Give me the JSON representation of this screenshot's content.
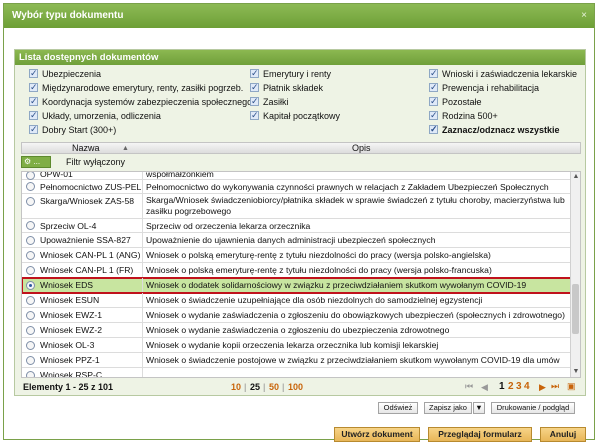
{
  "dialog": {
    "title": "Wybór typu dokumentu",
    "close": "×"
  },
  "panel": {
    "title": "Lista dostępnych dokumentów"
  },
  "filters": {
    "col1": [
      "Ubezpieczenia",
      "Międzynarodowe emerytury, renty, zasiłki pogrzeb.",
      "Koordynacja systemów zabezpieczenia społecznego",
      "Układy, umorzenia, odliczenia",
      "Dobry Start (300+)"
    ],
    "col2": [
      "Emerytury i renty",
      "Płatnik składek",
      "Zasiłki",
      "Kapitał początkowy"
    ],
    "col3": [
      "Wnioski i zaświadczenia lekarskie",
      "Prewencja i rehabilitacja",
      "Pozostałe",
      "Rodzina 500+",
      "Zaznacz/odznacz wszystkie"
    ]
  },
  "table": {
    "col_name": "Nazwa",
    "col_desc": "Opis",
    "filter_btn": "...",
    "filter_status": "Filtr wyłączony",
    "rows": [
      {
        "name": "OPW-01",
        "desc": "współmałżonkiem",
        "selected": false
      },
      {
        "name": "Pełnomocnictwo ZUS-PEL",
        "desc": "Pełnomocnictwo do wykonywania czynności prawnych w relacjach z Zakładem Ubezpieczeń Społecznych",
        "selected": false
      },
      {
        "name": "Skarga/Wniosek ZAS-58",
        "desc": "Skarga/Wniosek świadczeniobiorcy/płatnika składek w sprawie świadczeń z tytułu choroby, macierzyństwa lub zasiłku pogrzebowego",
        "selected": false
      },
      {
        "name": "Sprzeciw OL-4",
        "desc": "Sprzeciw od orzeczenia lekarza orzecznika",
        "selected": false
      },
      {
        "name": "Upoważnienie SSA-827",
        "desc": "Upoważnienie do ujawnienia danych administracji ubezpieczeń społecznych",
        "selected": false
      },
      {
        "name": "Wniosek CAN-PL 1 (ANG)",
        "desc": "Wniosek o polską emeryturę-rentę z tytułu niezdolności do pracy (wersja polsko-angielska)",
        "selected": false
      },
      {
        "name": "Wniosek CAN-PL 1 (FR)",
        "desc": "Wniosek o polską emeryturę-rentę z tytułu niezdolności do pracy (wersja polsko-francuska)",
        "selected": false
      },
      {
        "name": "Wniosek EDS",
        "desc": "Wniosek o dodatek solidarnościowy w związku z przeciwdziałaniem skutkom wywołanym COVID-19",
        "selected": true
      },
      {
        "name": "Wniosek ESUN",
        "desc": "Wniosek o świadczenie uzupełniające dla osób niezdolnych do samodzielnej egzystencji",
        "selected": false
      },
      {
        "name": "Wniosek EWZ-1",
        "desc": "Wniosek o wydanie zaświadczenia o zgłoszeniu do obowiązkowych ubezpieczeń (społecznych i zdrowotnego)",
        "selected": false
      },
      {
        "name": "Wniosek EWZ-2",
        "desc": "Wniosek o wydanie zaświadczenia o zgłoszeniu do ubezpieczenia zdrowotnego",
        "selected": false
      },
      {
        "name": "Wniosek OL-3",
        "desc": "Wniosek o wydanie kopii orzeczenia lekarza orzecznika lub komisji lekarskiej",
        "selected": false
      },
      {
        "name": "Wniosek PPZ-1",
        "desc": "Wniosek o świadczenie postojowe w związku z przeciwdziałaniem skutkom wywołanym COVID-19 dla umów",
        "selected": false
      },
      {
        "name": "Wniosek RSP-C",
        "desc": "",
        "selected": false
      }
    ]
  },
  "pager": {
    "count_label": "Elementy 1 - 25 z 101",
    "sizes": [
      "10",
      "25",
      "50",
      "100"
    ],
    "pages": [
      "1",
      "2",
      "3",
      "4"
    ],
    "first": "⏮",
    "prev": "◀",
    "next": "▶",
    "last": "⏭",
    "export": "▣"
  },
  "buttons": {
    "refresh": "Odśwież",
    "save_as": "Zapisz jako",
    "dropdown": "▼",
    "print": "Drukowanie / podgląd",
    "create": "Utwórz dokument",
    "browse": "Przeglądaj formularz",
    "cancel": "Anuluj"
  },
  "colors": {
    "accent": "#7aac3f",
    "selection_outline": "#c0121c",
    "selection_bg": "#c8e5a0",
    "page_link": "#c8640a",
    "button_gold": "#e8b658"
  }
}
